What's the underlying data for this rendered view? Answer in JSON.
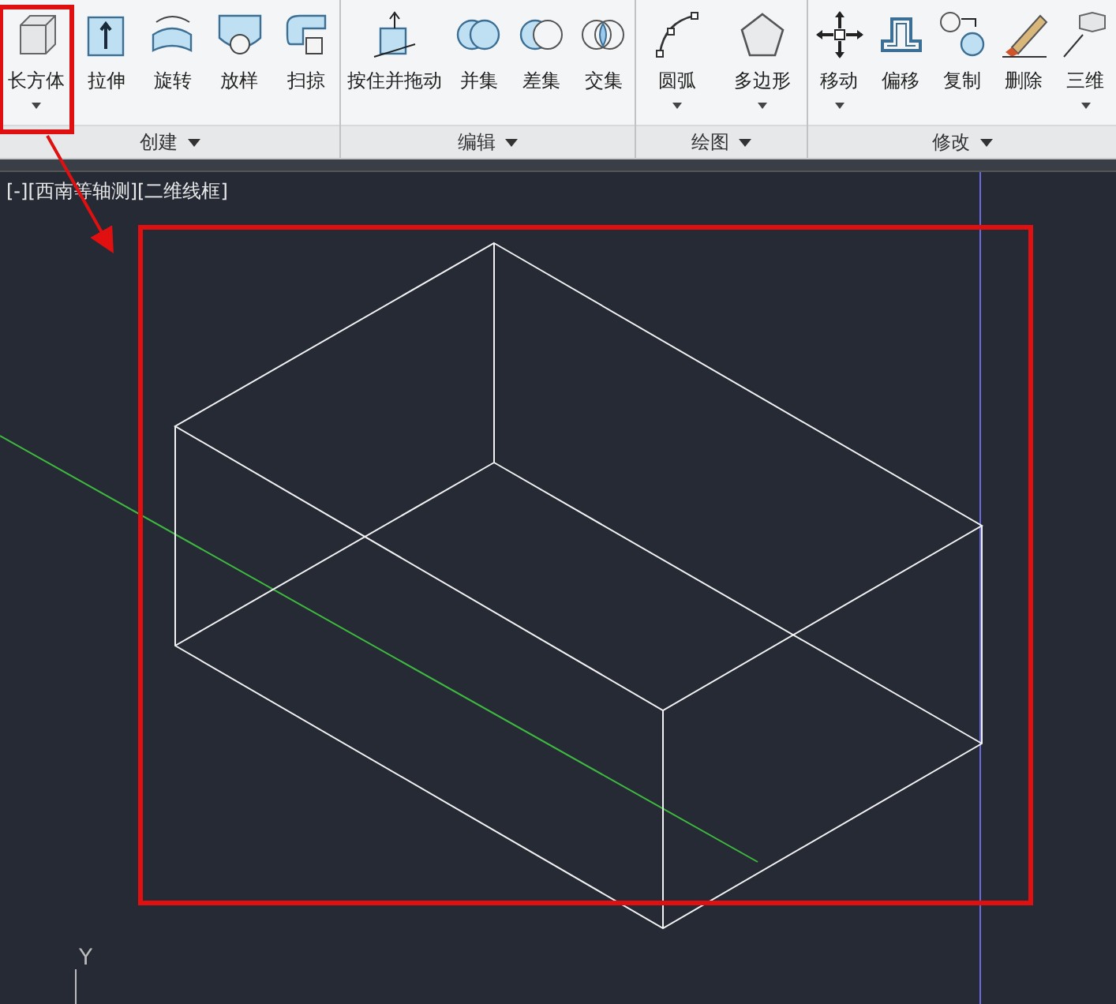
{
  "ribbon": {
    "panels": [
      {
        "title": "创建",
        "tools": [
          {
            "label": "长方体",
            "dropdown": true,
            "highlighted": true
          },
          {
            "label": "拉伸",
            "dropdown": false,
            "highlighted": false
          },
          {
            "label": "旋转",
            "dropdown": false,
            "highlighted": false
          },
          {
            "label": "放样",
            "dropdown": false,
            "highlighted": false
          },
          {
            "label": "扫掠",
            "dropdown": false,
            "highlighted": false
          }
        ]
      },
      {
        "title": "编辑",
        "tools": [
          {
            "label": "按住并拖动",
            "dropdown": false,
            "highlighted": false
          },
          {
            "label": "并集",
            "dropdown": false,
            "highlighted": false
          },
          {
            "label": "差集",
            "dropdown": false,
            "highlighted": false
          },
          {
            "label": "交集",
            "dropdown": false,
            "highlighted": false
          }
        ]
      },
      {
        "title": "绘图",
        "tools": [
          {
            "label": "圆弧",
            "dropdown": true,
            "highlighted": false
          },
          {
            "label": "多边形",
            "dropdown": true,
            "highlighted": false
          }
        ]
      },
      {
        "title": "修改",
        "tools": [
          {
            "label": "移动",
            "dropdown": true,
            "highlighted": false
          },
          {
            "label": "偏移",
            "dropdown": false,
            "highlighted": false
          },
          {
            "label": "复制",
            "dropdown": false,
            "highlighted": false
          },
          {
            "label": "删除",
            "dropdown": false,
            "highlighted": false
          },
          {
            "label": "三维",
            "dropdown": true,
            "highlighted": false
          }
        ]
      }
    ]
  },
  "viewport": {
    "label": "[-][西南等轴测][二维线框]",
    "ucs_label": "Y"
  }
}
